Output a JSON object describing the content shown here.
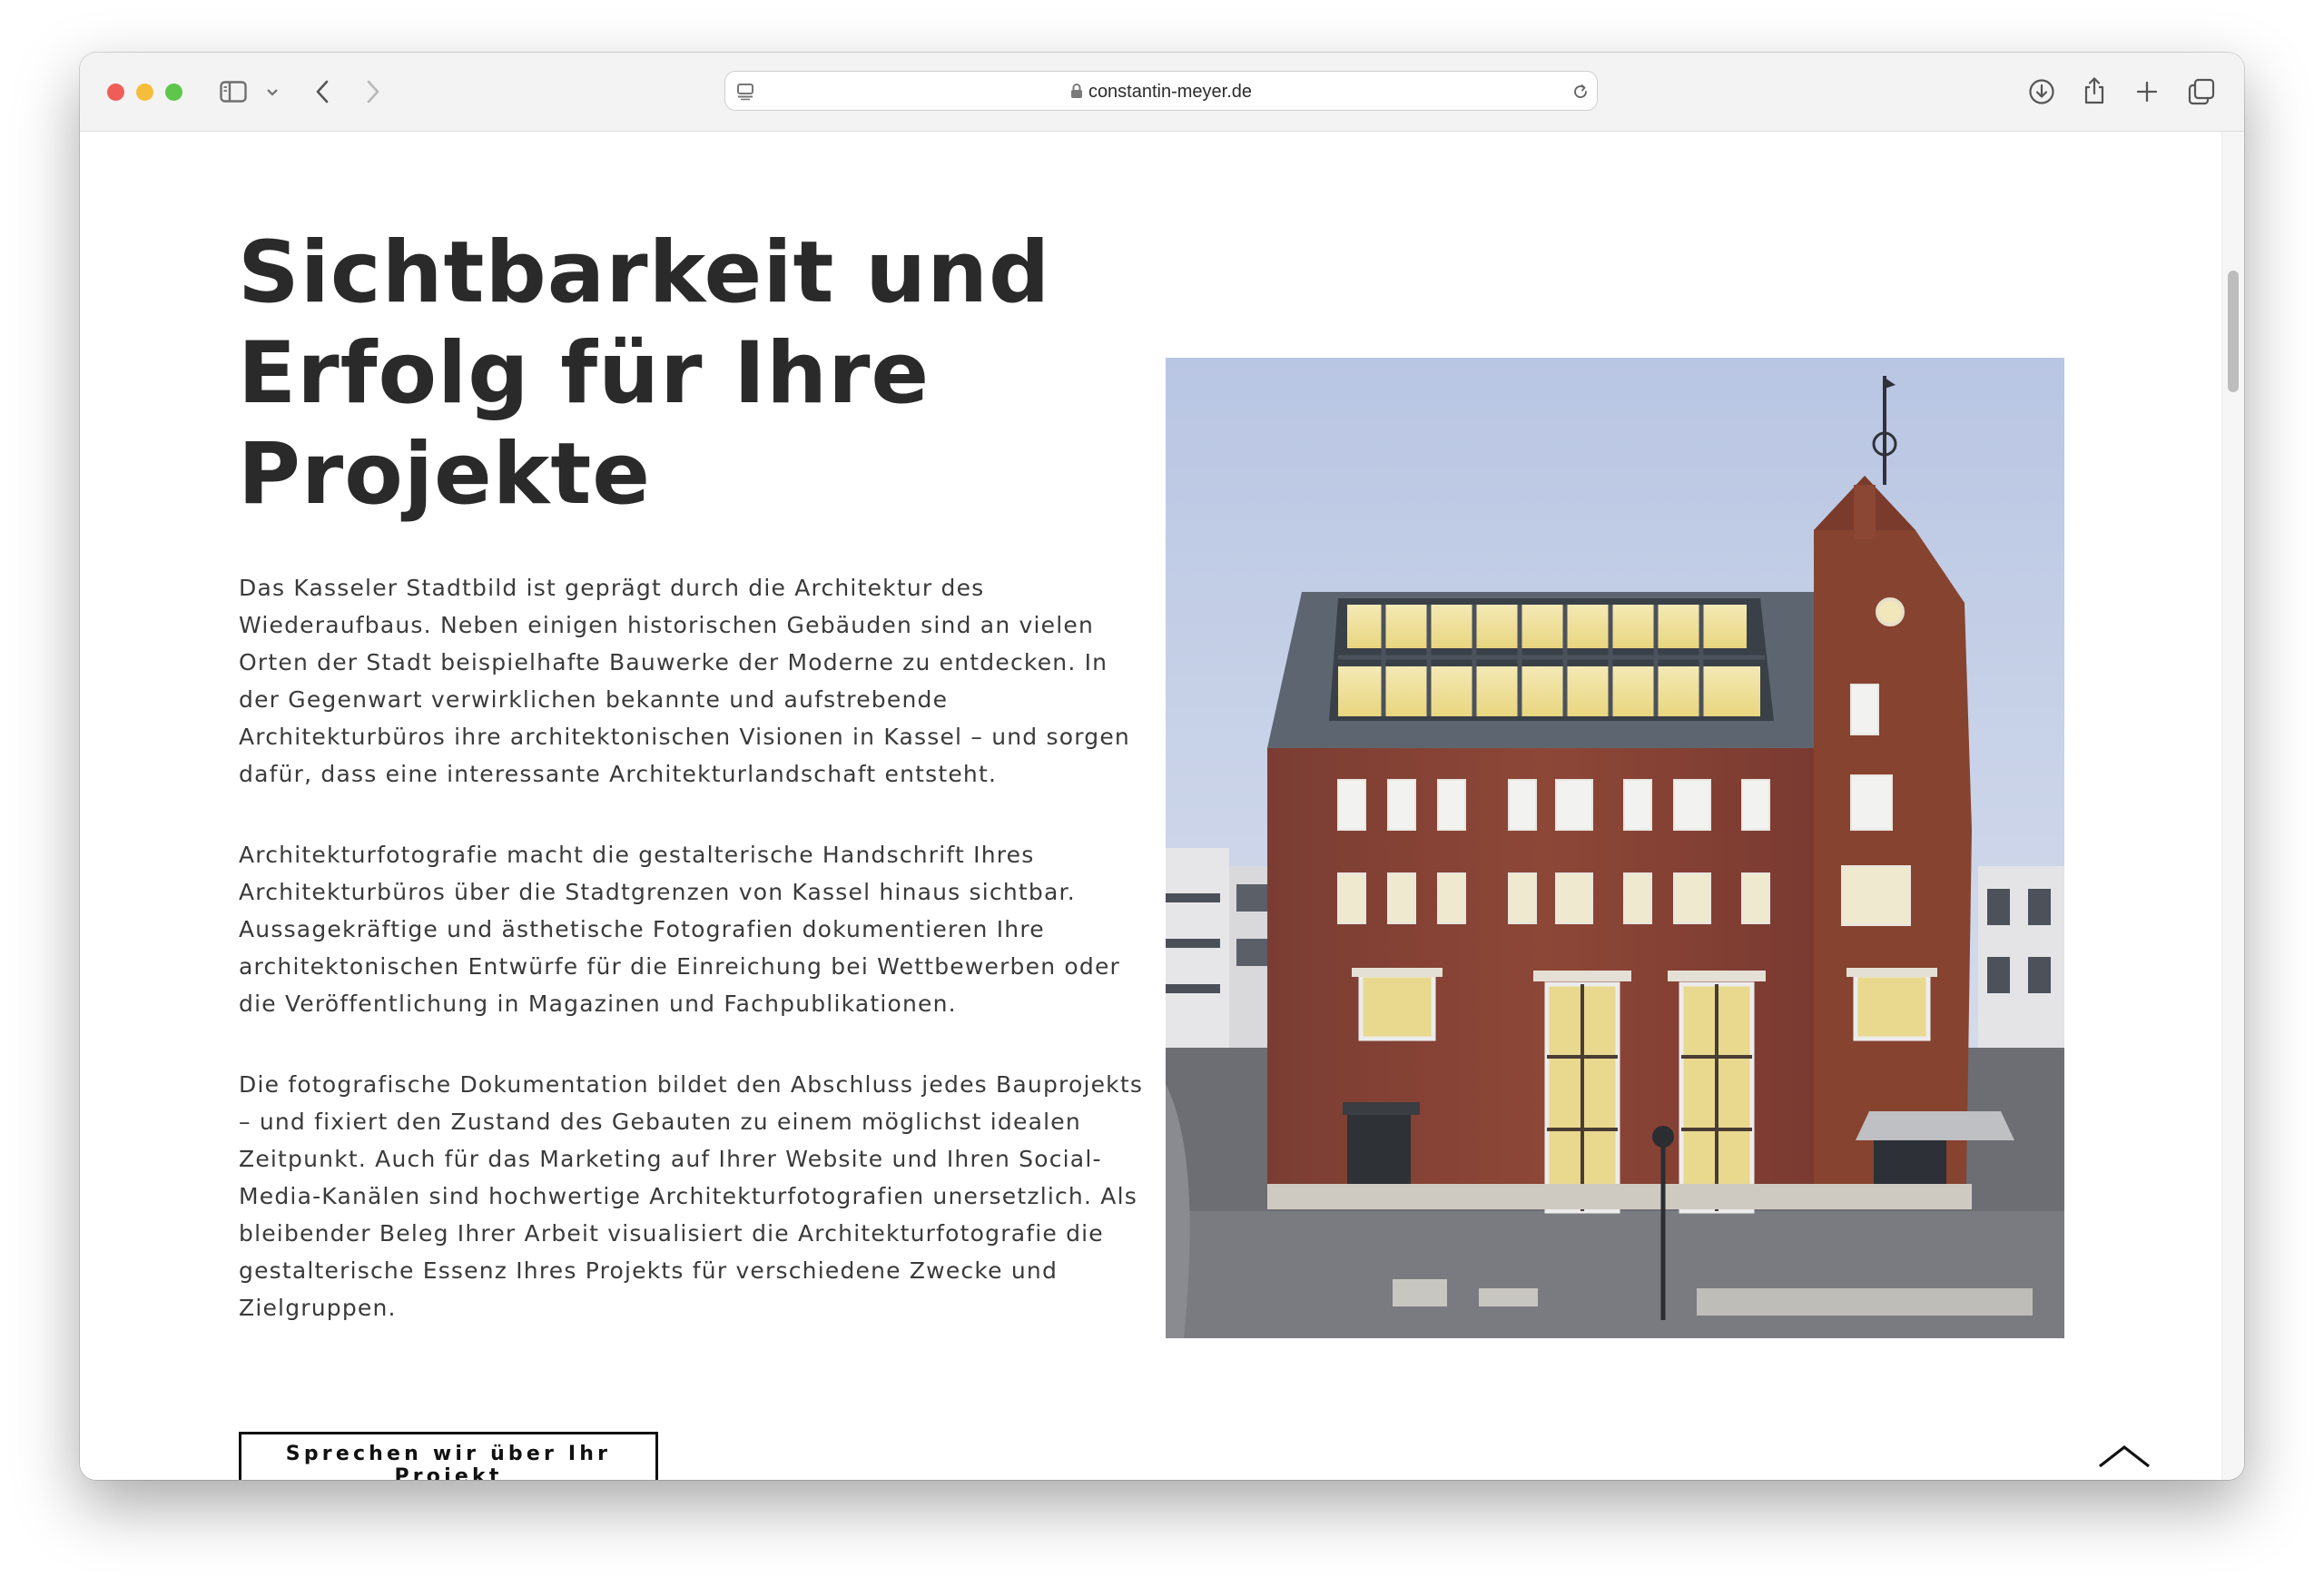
{
  "browser": {
    "url": "constantin-meyer.de",
    "icons": [
      "sidebar-icon",
      "chevron-down-icon",
      "back-icon",
      "forward-icon",
      "page-icon",
      "lock-icon",
      "reload-icon",
      "download-icon",
      "share-icon",
      "plus-icon",
      "tabs-icon"
    ]
  },
  "main": {
    "heading": "Sichtbarkeit und Erfolg für Ihre Projekte",
    "paragraphs": [
      "Das Kasseler Stadtbild ist geprägt durch die Architektur des Wiederaufbaus. Neben einigen historischen Gebäuden sind an vielen Orten der Stadt beispielhafte Bauwerke der Moderne zu entdecken. In der Gegenwart verwirklichen bekannte und aufstrebende Architekturbüros ihre architektonischen Visionen in Kassel – und sorgen dafür, dass eine interessante Architekturlandschaft entsteht.",
      "Architekturfotografie macht die gestalterische Handschrift Ihres Architekturbüros über die Stadtgrenzen von Kassel hinaus sichtbar. Aussagekräftige und ästhetische Fotografien dokumentieren Ihre architektonischen Entwürfe für die Einreichung bei Wettbewerben oder die Veröffentlichung in Magazinen und Fachpublikationen.",
      "Die fotografische Dokumentation bildet den Abschluss jedes Bauprojekts – und fixiert den Zustand des Gebauten zu einem möglichst idealen Zeitpunkt. Auch für das Marketing auf Ihrer Website und Ihren Social-Media-Kanälen sind hochwertige Architekturfotografien unersetzlich. Als bleibender Beleg Ihrer Arbeit visualisiert die Architekturfotografie die gestalterische Essenz Ihres Projekts für verschiedene Zwecke und Zielgruppen."
    ],
    "cta_label": "Sprechen wir über Ihr Projekt",
    "photo_icon": "building-photo",
    "to_top_icon": "chevron-up-icon"
  },
  "colors": {
    "text": "#2a2a2a",
    "brick": "#8a4436",
    "sky": "#c4cfe6"
  }
}
